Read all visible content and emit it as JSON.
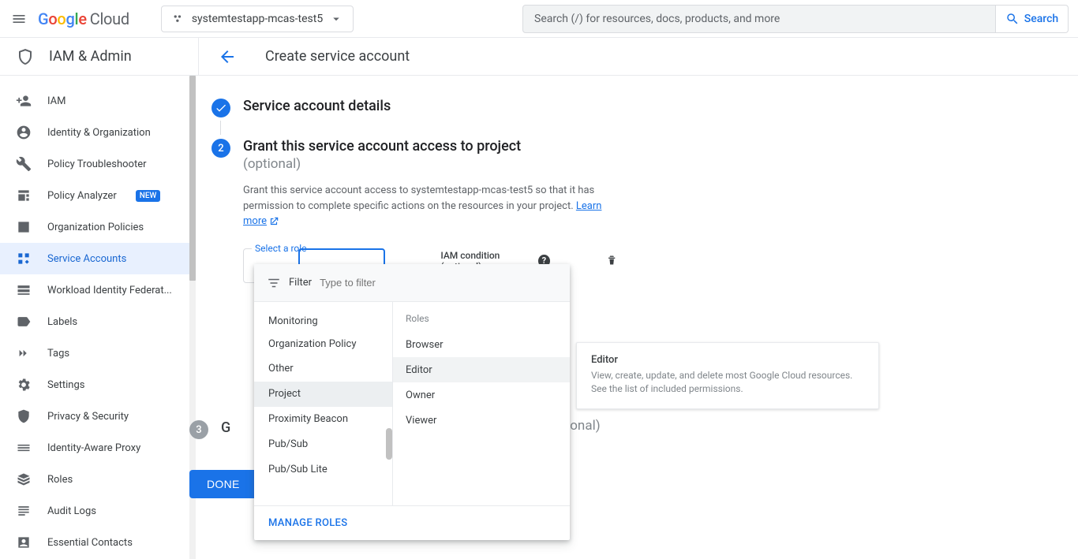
{
  "header": {
    "logo_cloud": "Cloud",
    "project_name": "systemtestapp-mcas-test5",
    "search_placeholder": "Search (/) for resources, docs, products, and more",
    "search_button": "Search"
  },
  "section": {
    "product": "IAM & Admin",
    "page_title": "Create service account"
  },
  "sidebar": {
    "items": [
      {
        "label": "IAM"
      },
      {
        "label": "Identity & Organization"
      },
      {
        "label": "Policy Troubleshooter"
      },
      {
        "label": "Policy Analyzer",
        "badge": "NEW"
      },
      {
        "label": "Organization Policies"
      },
      {
        "label": "Service Accounts",
        "active": true
      },
      {
        "label": "Workload Identity Federat..."
      },
      {
        "label": "Labels"
      },
      {
        "label": "Tags"
      },
      {
        "label": "Settings"
      },
      {
        "label": "Privacy & Security"
      },
      {
        "label": "Identity-Aware Proxy"
      },
      {
        "label": "Roles"
      },
      {
        "label": "Audit Logs"
      },
      {
        "label": "Essential Contacts"
      }
    ]
  },
  "steps": {
    "step1_title": "Service account details",
    "step2_title": "Grant this service account access to project",
    "step2_optional": "(optional)",
    "step2_desc_a": "Grant this service account access to systemtestapp-mcas-test5 so that it has permission to complete specific actions on the resources in your project. ",
    "step2_learn_more": "Learn more",
    "step3_optional_peek": "ptional)",
    "number2": "2",
    "number3": "3"
  },
  "role_picker": {
    "select_label": "Select a role",
    "iam_condition": "IAM condition (optional)",
    "filter_label": "Filter",
    "filter_placeholder": "Type to filter",
    "categories": [
      "Monitoring",
      "Organization Policy",
      "Other",
      "Project",
      "Proximity Beacon",
      "Pub/Sub",
      "Pub/Sub Lite"
    ],
    "selected_category_index": 3,
    "roles_header": "Roles",
    "roles": [
      "Browser",
      "Editor",
      "Owner",
      "Viewer"
    ],
    "hover_role_index": 1,
    "manage_roles": "MANAGE ROLES"
  },
  "tooltip": {
    "title": "Editor",
    "desc": "View, create, update, and delete most Google Cloud resources. See the list of included permissions."
  },
  "buttons": {
    "done": "DONE"
  }
}
